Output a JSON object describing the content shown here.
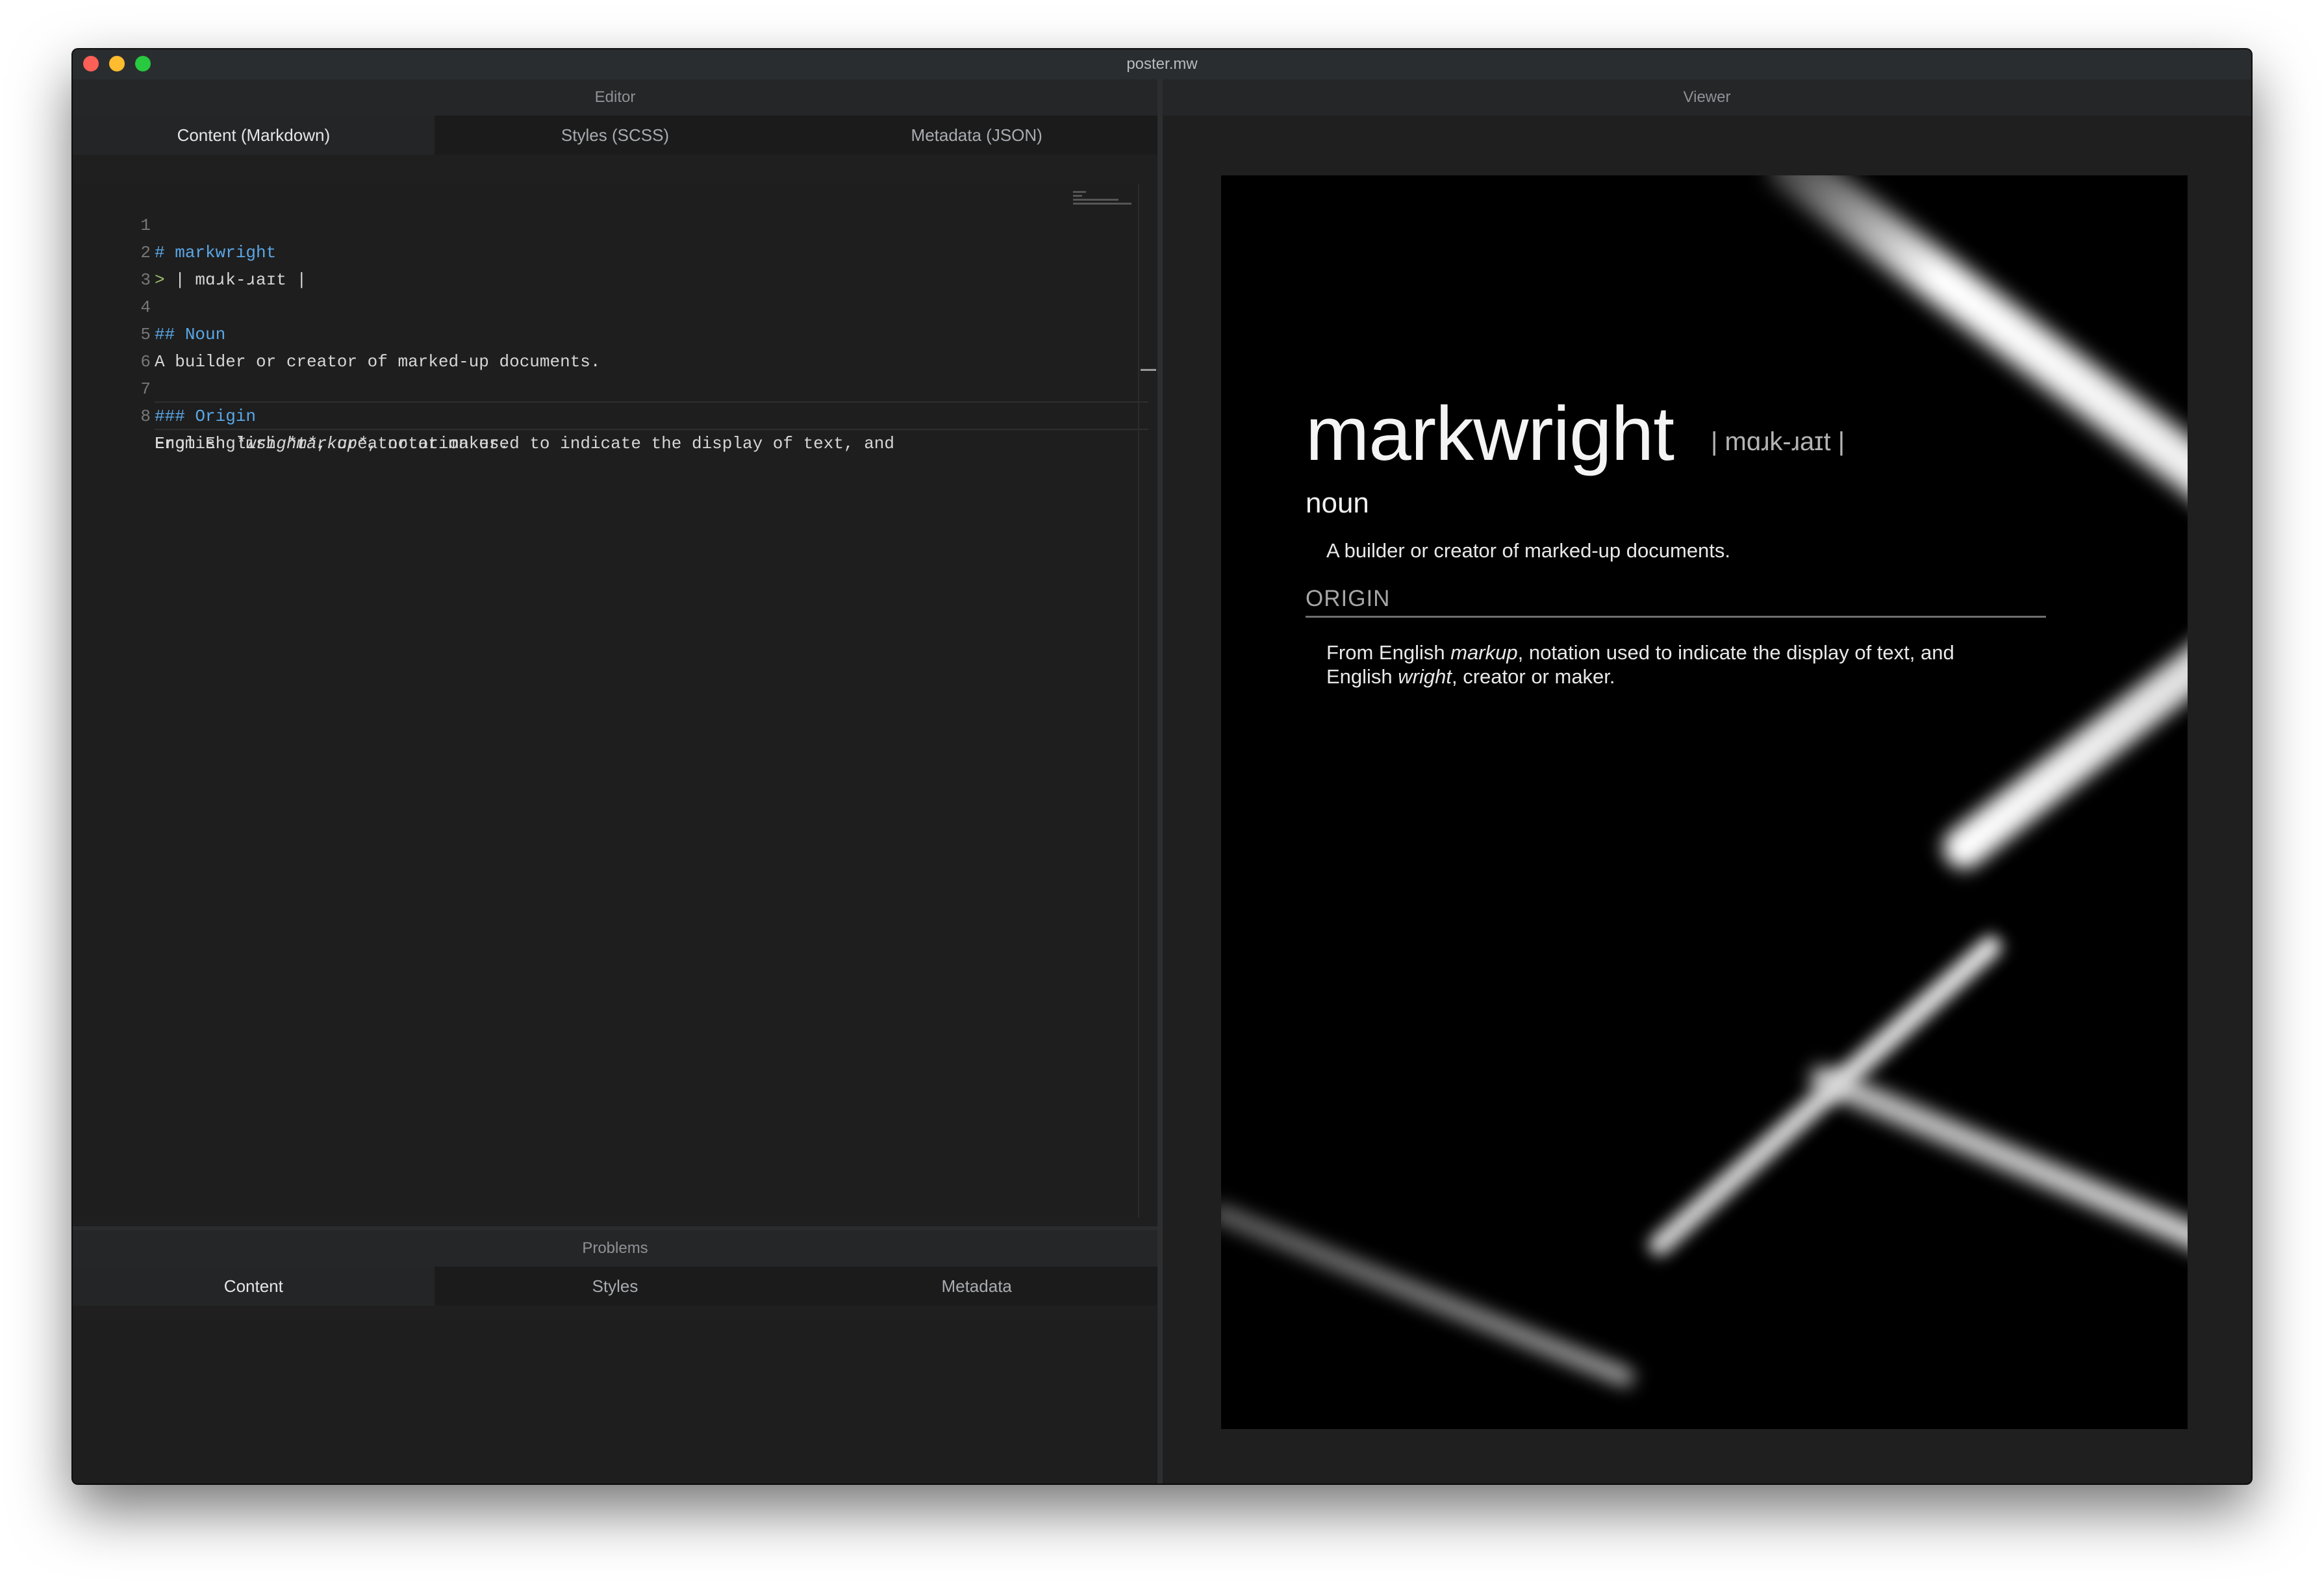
{
  "window": {
    "title": "poster.mw"
  },
  "editor": {
    "header": "Editor",
    "tabs": [
      {
        "label": "Content (Markdown)",
        "active": true
      },
      {
        "label": "Styles (SCSS)",
        "active": false
      },
      {
        "label": "Metadata (JSON)",
        "active": false
      }
    ],
    "lines": {
      "l1": {
        "num": "1",
        "hash": "#",
        "text": "markwright"
      },
      "l2": {
        "num": "2",
        "gt": ">",
        "text": "| mɑɹk-ɹaɪt |"
      },
      "l3": {
        "num": "3"
      },
      "l4": {
        "num": "4",
        "hash": "##",
        "text": "Noun"
      },
      "l5": {
        "num": "5",
        "text": "A builder or creator of marked-up documents."
      },
      "l6": {
        "num": "6"
      },
      "l7": {
        "num": "7",
        "hash": "###",
        "text": "Origin"
      },
      "l8": {
        "num": "8",
        "part1": "From English ",
        "em1": "*markup*",
        "part2": ", notation used to indicate the display of text, and",
        "wrap1": "English ",
        "em2": "*wright*",
        "wrap2": ", creator or maker."
      }
    }
  },
  "problems": {
    "header": "Problems",
    "tabs": [
      {
        "label": "Content",
        "active": true
      },
      {
        "label": "Styles",
        "active": false
      },
      {
        "label": "Metadata",
        "active": false
      }
    ]
  },
  "viewer": {
    "header": "Viewer",
    "poster": {
      "title": "markwright",
      "pronunciation": "| mɑɹk-ɹaɪt |",
      "part_of_speech": "noun",
      "definition": "A builder or creator of marked-up documents.",
      "origin_heading": "ORIGIN",
      "etymology": {
        "a": "From English ",
        "em1": "markup",
        "b": ", notation used to indicate the display of text, and",
        "c": "English ",
        "em2": "wright",
        "d": ", creator or maker."
      }
    }
  }
}
